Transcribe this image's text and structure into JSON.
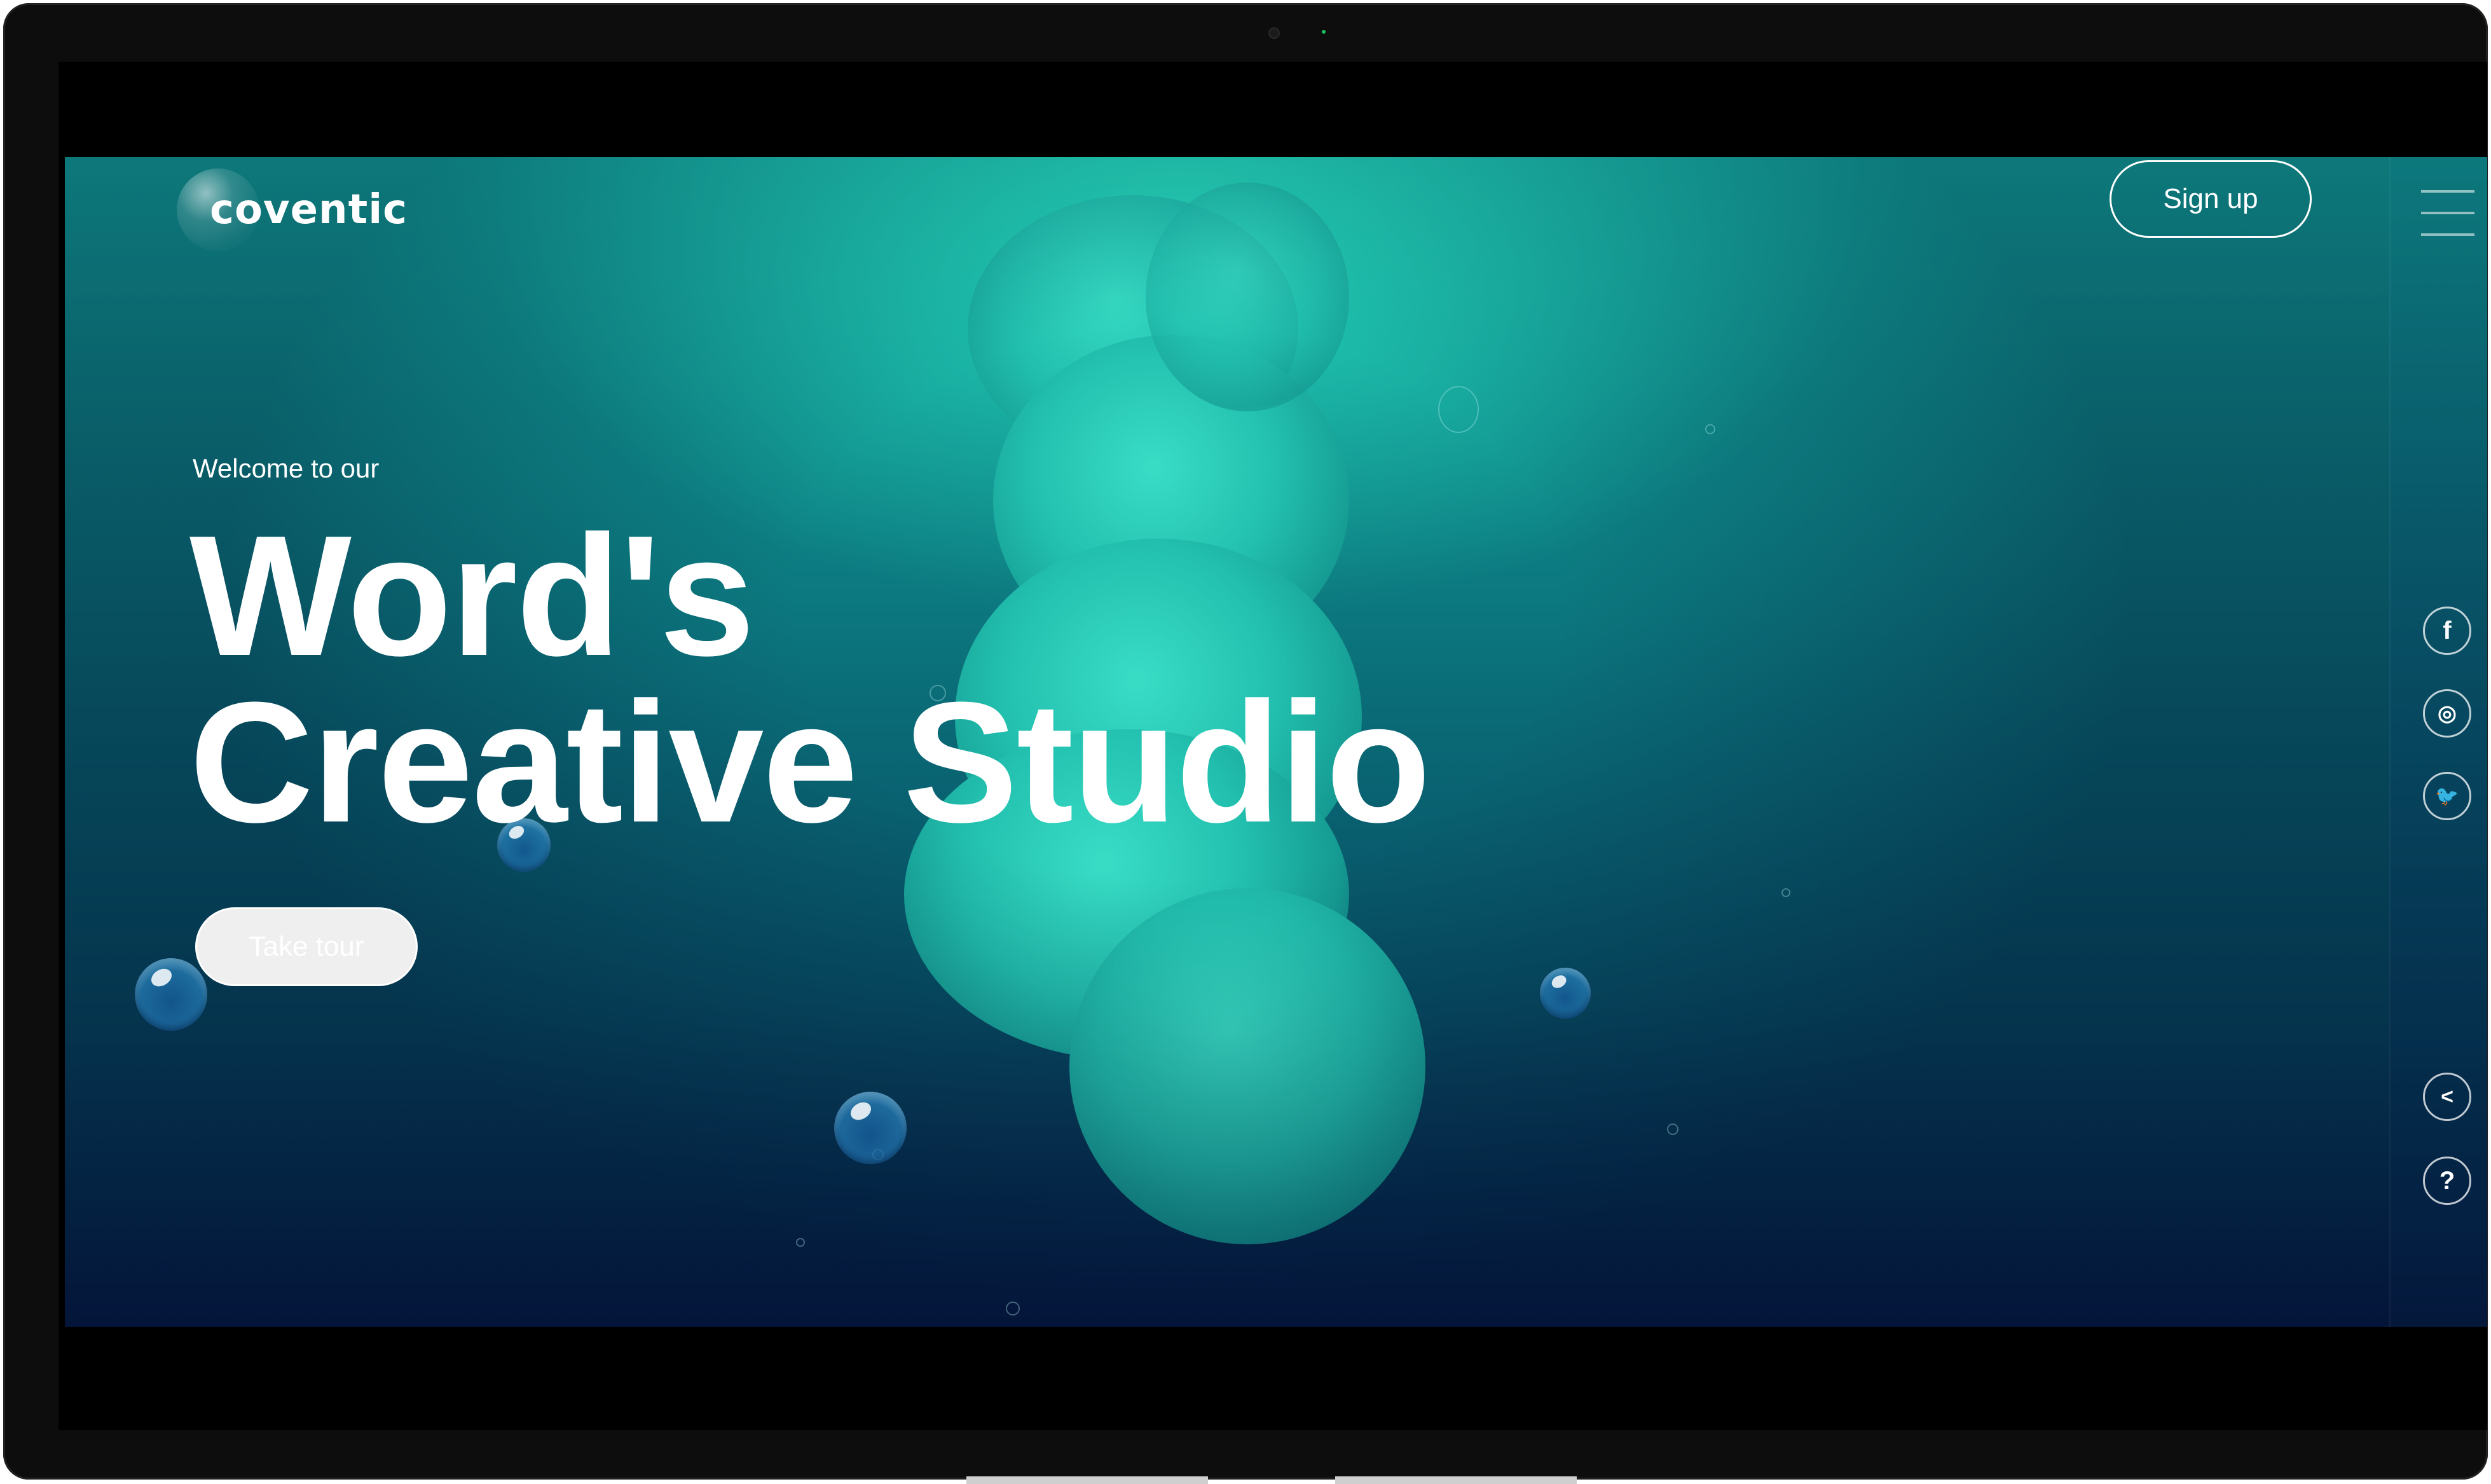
{
  "brand": {
    "logo_text": "coventic"
  },
  "header": {
    "signup_label": "Sign up",
    "menu_icon": "hamburger-menu-icon"
  },
  "hero": {
    "welcome": "Welcome to our",
    "headline_line1": "Word's",
    "headline_line2": "Creative Studio",
    "cta_label": "Take tour"
  },
  "social": [
    {
      "name": "facebook-icon",
      "glyph": "f"
    },
    {
      "name": "instagram-icon",
      "glyph": "◎"
    },
    {
      "name": "twitter-icon",
      "glyph": "🐦"
    }
  ],
  "utility": [
    {
      "name": "share-icon",
      "glyph": "<"
    },
    {
      "name": "help-icon",
      "glyph": "?"
    }
  ],
  "colors": {
    "accent_teal": "#22bfae",
    "deep_navy": "#061a43",
    "text": "#ffffff"
  }
}
